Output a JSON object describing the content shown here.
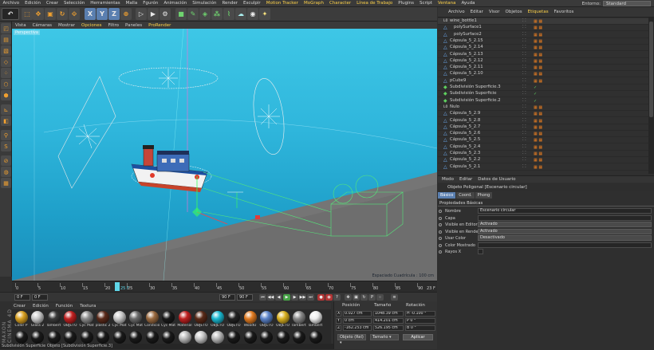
{
  "menubar": {
    "items": [
      "Archivo",
      "Edición",
      "Crear",
      "Selección",
      "Herramientas",
      "Malla",
      "Fgurón",
      "Animación",
      "Simulación",
      "Render",
      "Esculpir",
      "Motion Tracker",
      "MoGraph",
      "Character",
      "Línea de Trabajo",
      "Plugins",
      "Script",
      "Ventana",
      "Ayuda"
    ],
    "layout_label": "Entorno:",
    "layout_value": "Standard"
  },
  "toolbar": {
    "axis_x": "X",
    "axis_y": "Y",
    "axis_z": "Z"
  },
  "viewport": {
    "menu": [
      "Vista",
      "Cámaras",
      "Mostrar",
      "Opciones",
      "Filtro",
      "Paneles",
      "ProRender"
    ],
    "label": "Perspectiva",
    "grid_text": "Espaciado Cuadrícula : 100 cm"
  },
  "timeline": {
    "ticks": [
      "0",
      "5",
      "10",
      "15",
      "20",
      "25",
      "30",
      "35",
      "40",
      "45",
      "50",
      "55",
      "60",
      "65",
      "70",
      "75",
      "80",
      "85",
      "90"
    ],
    "playhead_label": "25 F",
    "end_label": "23 F"
  },
  "transport": {
    "start": "0 F",
    "current": "0 F",
    "end": "90 F",
    "end2": "90 F"
  },
  "materials": {
    "menu": [
      "Crear",
      "Edición",
      "Función",
      "Textura"
    ],
    "items": [
      {
        "label": "Color P",
        "color": "#d9a020"
      },
      {
        "label": "Glass 2",
        "color": "#c8c8c8"
      },
      {
        "label": "lambert",
        "color": "#3a3a3a"
      },
      {
        "label": "OBJETO",
        "color": "#c02020"
      },
      {
        "label": "Cyc Mat",
        "color": "#8a8a8a"
      },
      {
        "label": "plastic 2",
        "color": "#5b2a1a"
      },
      {
        "label": "Cyc Mat",
        "color": "#c8c8c8"
      },
      {
        "label": "Cyc Mat",
        "color": "#6a6a6a"
      },
      {
        "label": "Condición",
        "color": "#9a6a40"
      },
      {
        "label": "Cyc Mat",
        "color": "#1a1a1a"
      },
      {
        "label": "Material",
        "color": "#c02020"
      },
      {
        "label": "OBJETO",
        "color": "#5a2a18"
      },
      {
        "label": "OBJETO",
        "color": "#1ab8d0"
      },
      {
        "label": "OBJETO",
        "color": "#222222"
      },
      {
        "label": "WoodU",
        "color": "#e07a20"
      },
      {
        "label": "OBJETO",
        "color": "#5a82c8"
      },
      {
        "label": "OBJETO",
        "color": "#d9b020"
      },
      {
        "label": "lambert",
        "color": "#888888"
      },
      {
        "label": "lambert",
        "color": "#eeeeee"
      },
      {
        "label": "",
        "color": "#1a1a1a"
      },
      {
        "label": "",
        "color": "#1a1a1a"
      },
      {
        "label": "",
        "color": "#1a1a1a"
      },
      {
        "label": "",
        "color": "#1a1a1a"
      },
      {
        "label": "",
        "color": "#1a1a1a"
      },
      {
        "label": "",
        "color": "#1a1a1a"
      },
      {
        "label": "",
        "color": "#1a1a1a"
      },
      {
        "label": "",
        "color": "#1a1a1a"
      },
      {
        "label": "",
        "color": "#1a1a1a"
      },
      {
        "label": "",
        "color": "#1a1a1a"
      },
      {
        "label": "",
        "color": "#b8b8b8"
      },
      {
        "label": "",
        "color": "#c8c8c8"
      },
      {
        "label": "",
        "color": "#b8b8b8"
      },
      {
        "label": "",
        "color": "#1a1a1a"
      },
      {
        "label": "",
        "color": "#1a1a1a"
      },
      {
        "label": "",
        "color": "#1a1a1a"
      },
      {
        "label": "",
        "color": "#1a1a1a"
      },
      {
        "label": "",
        "color": "#1a1a1a"
      },
      {
        "label": "",
        "color": "#1a1a1a"
      }
    ]
  },
  "coords": {
    "headers": [
      "Posición",
      "Tamaño",
      "Rotación"
    ],
    "rows": [
      {
        "axis": "X",
        "pos": "0.027 cm",
        "size": "1048.39 cm",
        "rot": "H  -0.100 °"
      },
      {
        "axis": "Y",
        "pos": "0 cm",
        "size": "414.201 cm",
        "rot": "P  0 °"
      },
      {
        "axis": "Z",
        "pos": "-162.253 cm",
        "size": "526.195 cm",
        "rot": "B  0 °"
      }
    ],
    "mode1": "Objeto (Rel) ▾",
    "mode2": "Tamaño ▾",
    "apply": "Aplicar"
  },
  "status": "Subdivisión Superficie Objeto [Subdivisión Superficie.3]",
  "brand": "MAXON CINEMA 4D",
  "object_manager": {
    "menu": [
      "Archivo",
      "Editar",
      "Visor",
      "Objetos",
      "Etiquetas",
      "Favoritos"
    ],
    "rows": [
      {
        "name": "wine_bottle1",
        "icon": "L0"
      },
      {
        "name": "polySurface1",
        "icon": "△"
      },
      {
        "name": "polySurface2",
        "icon": "△"
      },
      {
        "name": "Cápsula_5_2.15",
        "icon": "△"
      },
      {
        "name": "Cápsula_5_2.14",
        "icon": "△"
      },
      {
        "name": "Cápsula_5_2.13",
        "icon": "△"
      },
      {
        "name": "Cápsula_5_2.12",
        "icon": "△"
      },
      {
        "name": "Cápsula_5_2.11",
        "icon": "△"
      },
      {
        "name": "Cápsula_5_2.10",
        "icon": "△"
      },
      {
        "name": "pCube9",
        "icon": "△"
      },
      {
        "name": "Subdivisión Superficie.3",
        "icon": "◆"
      },
      {
        "name": "Subdivisión Superficie",
        "icon": "◆"
      },
      {
        "name": "Subdivisión Superficie.2",
        "icon": "◆"
      },
      {
        "name": "Nulo",
        "icon": "L0"
      },
      {
        "name": "Cápsula_5_2.9",
        "icon": "△"
      },
      {
        "name": "Cápsula_5_2.8",
        "icon": "△"
      },
      {
        "name": "Cápsula_5_2.7",
        "icon": "△"
      },
      {
        "name": "Cápsula_5_2.6",
        "icon": "△"
      },
      {
        "name": "Cápsula_5_2.5",
        "icon": "△"
      },
      {
        "name": "Cápsula_5_2.4",
        "icon": "△"
      },
      {
        "name": "Cápsula_5_2.3",
        "icon": "△"
      },
      {
        "name": "Cápsula_5_2.2",
        "icon": "△"
      },
      {
        "name": "Cápsula_5_2.1",
        "icon": "△"
      }
    ]
  },
  "attributes": {
    "menu": [
      "Modo",
      "Editar",
      "Datos de Usuario"
    ],
    "title": "Objeto Poligonal [Escenario circular]",
    "tabs": [
      "Básico",
      "Coord.",
      "Phong"
    ],
    "section": "Propiedades Básicas",
    "fields": [
      {
        "label": "Nombre",
        "value": "Escenario circular",
        "type": "text"
      },
      {
        "label": "Capa",
        "value": "",
        "type": "text"
      },
      {
        "label": "Visible en Editor",
        "value": "Activado",
        "type": "drop"
      },
      {
        "label": "Visible en Render",
        "value": "Activado",
        "type": "drop"
      },
      {
        "label": "Usar Color",
        "value": "Desactivado",
        "type": "drop"
      },
      {
        "label": "Color Mostrado",
        "value": "",
        "type": "text"
      },
      {
        "label": "Rayos X",
        "value": "",
        "type": "check"
      }
    ]
  }
}
